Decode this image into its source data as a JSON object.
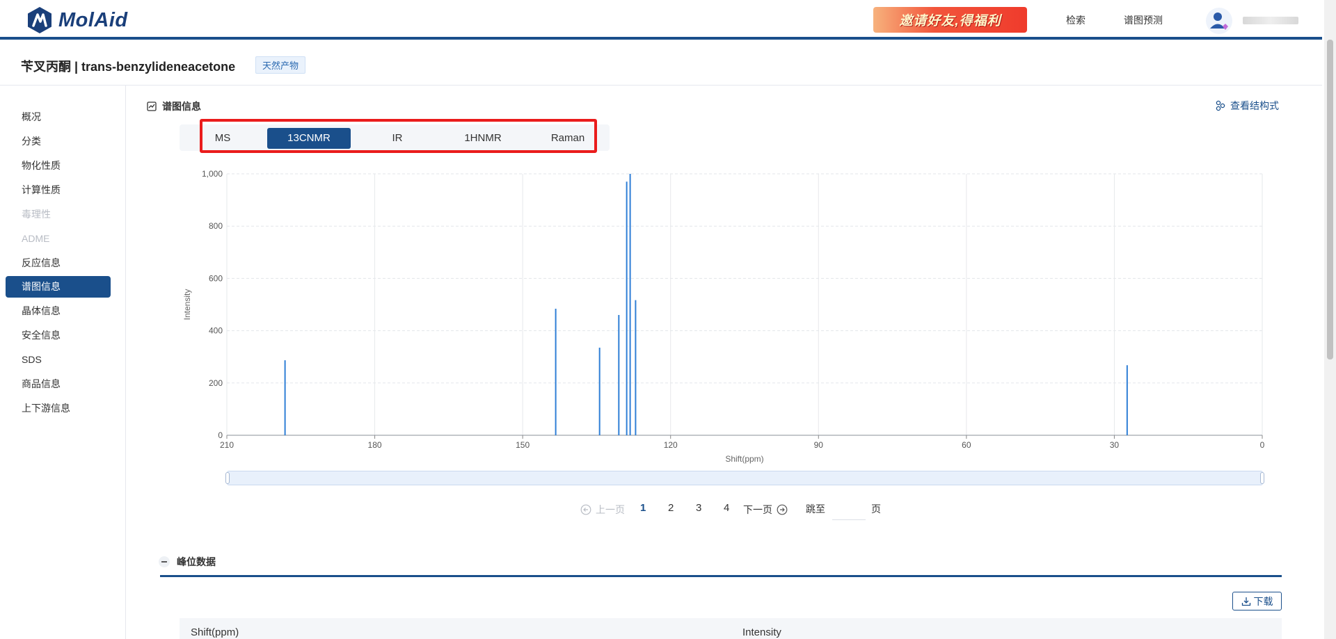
{
  "header": {
    "logo_text": "MolAid",
    "promo_text": "邀请好友,得福利",
    "nav": [
      "检索",
      "谱图预测"
    ]
  },
  "title_bar": {
    "compound_title": "苄叉丙酮 | trans-benzylideneacetone",
    "tag": "天然产物"
  },
  "sidebar": {
    "items": [
      {
        "label": "概况",
        "state": "normal"
      },
      {
        "label": "分类",
        "state": "normal"
      },
      {
        "label": "物化性质",
        "state": "normal"
      },
      {
        "label": "计算性质",
        "state": "normal"
      },
      {
        "label": "毒理性",
        "state": "disabled"
      },
      {
        "label": "ADME",
        "state": "disabled"
      },
      {
        "label": "反应信息",
        "state": "normal"
      },
      {
        "label": "谱图信息",
        "state": "active"
      },
      {
        "label": "晶体信息",
        "state": "normal"
      },
      {
        "label": "安全信息",
        "state": "normal"
      },
      {
        "label": "SDS",
        "state": "normal"
      },
      {
        "label": "商品信息",
        "state": "normal"
      },
      {
        "label": "上下游信息",
        "state": "normal"
      }
    ]
  },
  "section": {
    "title": "谱图信息",
    "view_structure": "查看结构式"
  },
  "spectrum_tabs": {
    "items": [
      "MS",
      "13CNMR",
      "IR",
      "1HNMR",
      "Raman"
    ],
    "active": "13CNMR"
  },
  "chart_data": {
    "type": "bar",
    "xlabel": "Shift(ppm)",
    "ylabel": "Intensity",
    "xlim": [
      210,
      0
    ],
    "x_reversed": true,
    "ylim": [
      0,
      1000
    ],
    "x_ticks": [
      "210",
      "180",
      "150",
      "120",
      "90",
      "60",
      "30",
      "0"
    ],
    "y_ticks": [
      "0",
      "200",
      "400",
      "600",
      "800",
      "1,000"
    ],
    "grid": true,
    "series": [
      {
        "color": "#2f7fd6",
        "points": [
          {
            "x": 198.2,
            "y": 287
          },
          {
            "x": 143.3,
            "y": 484
          },
          {
            "x": 134.4,
            "y": 335
          },
          {
            "x": 130.5,
            "y": 460
          },
          {
            "x": 128.9,
            "y": 970
          },
          {
            "x": 128.2,
            "y": 1000
          },
          {
            "x": 127.1,
            "y": 517
          },
          {
            "x": 27.4,
            "y": 268
          }
        ]
      }
    ]
  },
  "pagination": {
    "prev": "上一页",
    "pages": [
      "1",
      "2",
      "3",
      "4"
    ],
    "current": "1",
    "next": "下一页",
    "jump_label": "跳至",
    "page_suffix": "页",
    "jump_value": ""
  },
  "peak_data": {
    "title": "峰位数据",
    "download_label": "下载",
    "columns": [
      "Shift(ppm)",
      "Intensity"
    ]
  },
  "colors": {
    "brand": "#1a4f8b",
    "highlight": "#ea1c1c",
    "peak": "#2f7fd6"
  }
}
